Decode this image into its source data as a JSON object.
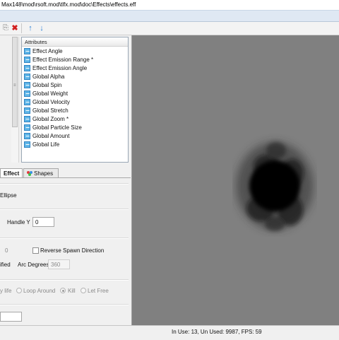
{
  "window": {
    "title": "Max148\\mod\\rsoft.mod\\tlfx.mod\\doc\\Effects\\effects.eff"
  },
  "toolbar": {
    "icons": [
      "copy-icon",
      "delete-icon",
      "move-up-icon",
      "move-down-icon"
    ],
    "colors": {
      "delete": "#d21e1e",
      "arrows": "#2a7fd4"
    }
  },
  "attributes": {
    "header": "Attributes",
    "items": [
      "Effect Angle",
      "Effect Emission Range *",
      "Effect Emission Angle",
      "Global Alpha",
      "Global Spin",
      "Global Weight",
      "Global Velocity",
      "Global Stretch",
      "Global Zoom *",
      "Global Particle Size",
      "Global Amount",
      "Global Life"
    ]
  },
  "tabs": [
    {
      "label": "Effect",
      "active": true
    },
    {
      "label": "Shapes",
      "active": false
    }
  ],
  "properties": {
    "shape_value": "Ellipse",
    "handle_y_label": "Handle Y",
    "handle_y_value": "0",
    "zero_value": "0",
    "reverse_spawn_label": "Reverse Spawn Direction",
    "reverse_spawn_checked": false,
    "specified_label": "ified",
    "arc_degrees_label": "Arc Degrees",
    "arc_degrees_value": "360",
    "end_behaviour": {
      "options": [
        "y life",
        "Loop Around",
        "Kill",
        "Let Free"
      ],
      "selected": "Kill"
    },
    "bottom_field_value": ""
  },
  "canvas": {
    "background": "#808080",
    "particle_color": "#000000"
  },
  "status": {
    "text": "In Use: 13, Un Used: 9987, FPS: 59"
  }
}
